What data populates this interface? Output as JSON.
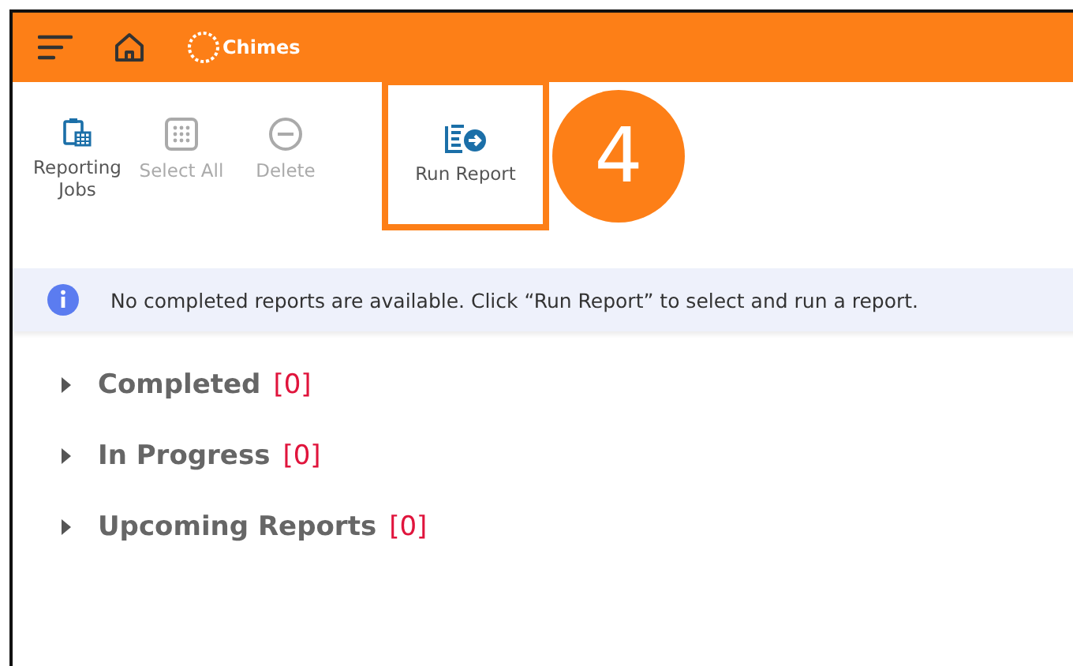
{
  "header": {
    "logo": "Chimes"
  },
  "toolbar": [
    {
      "label": "Reporting Jobs",
      "kind": "clipboard",
      "disabled": false,
      "highlighted": false
    },
    {
      "label": "Select All",
      "kind": "grid",
      "disabled": true,
      "highlighted": false
    },
    {
      "label": "Delete",
      "kind": "minus",
      "disabled": true,
      "highlighted": false
    },
    {
      "label": "Run Report",
      "kind": "run",
      "disabled": false,
      "highlighted": true
    }
  ],
  "callout": "4",
  "info": "No completed reports are available. Click “Run Report” to select and run a report.",
  "sections": [
    {
      "title": "Completed",
      "count": "[0]",
      "expanded": false
    },
    {
      "title": "In Progress",
      "count": "[0]",
      "expanded": false
    },
    {
      "title": "Upcoming Reports",
      "count": "[0]",
      "expanded": false
    }
  ]
}
